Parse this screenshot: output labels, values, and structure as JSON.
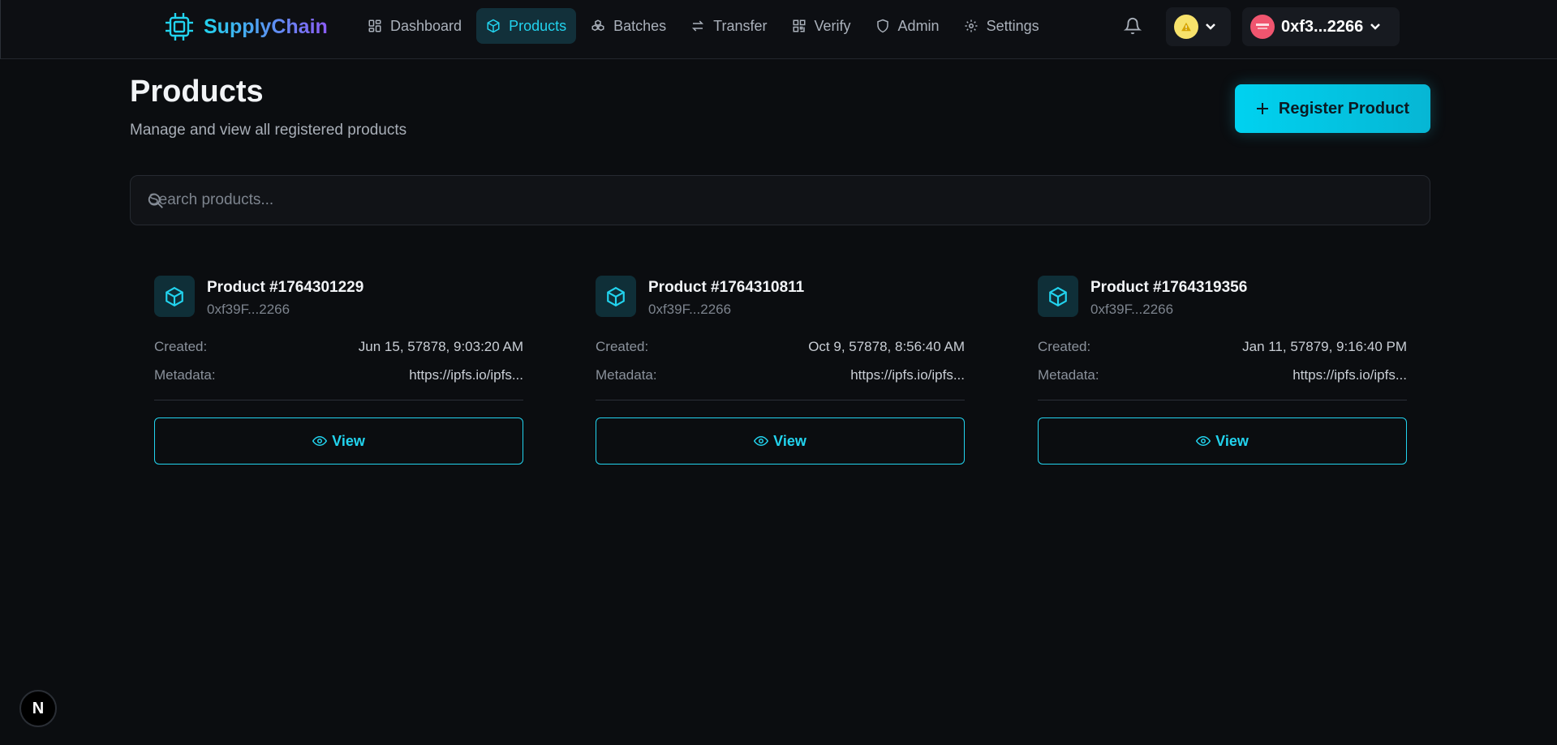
{
  "app": {
    "name": "SupplyChain"
  },
  "nav": {
    "items": [
      {
        "label": "Dashboard",
        "icon": "grid-icon",
        "active": false
      },
      {
        "label": "Products",
        "icon": "box-icon",
        "active": true
      },
      {
        "label": "Batches",
        "icon": "boxes-icon",
        "active": false
      },
      {
        "label": "Transfer",
        "icon": "arrows-icon",
        "active": false
      },
      {
        "label": "Verify",
        "icon": "qr-icon",
        "active": false
      },
      {
        "label": "Admin",
        "icon": "shield-icon",
        "active": false
      },
      {
        "label": "Settings",
        "icon": "gear-icon",
        "active": false
      }
    ]
  },
  "account": {
    "address": "0xf3...2266"
  },
  "page": {
    "title": "Products",
    "subtitle": "Manage and view all registered products",
    "register_label": "Register Product"
  },
  "search": {
    "placeholder": "Search products..."
  },
  "labels": {
    "created": "Created:",
    "metadata": "Metadata:",
    "view": "View"
  },
  "products": [
    {
      "title": "Product #1764301229",
      "owner": "0xf39F...2266",
      "created": "Jun 15, 57878, 9:03:20 AM",
      "metadata": "https://ipfs.io/ipfs..."
    },
    {
      "title": "Product #1764310811",
      "owner": "0xf39F...2266",
      "created": "Oct 9, 57878, 8:56:40 AM",
      "metadata": "https://ipfs.io/ipfs..."
    },
    {
      "title": "Product #1764319356",
      "owner": "0xf39F...2266",
      "created": "Jan 11, 57879, 9:16:40 PM",
      "metadata": "https://ipfs.io/ipfs..."
    }
  ],
  "badge": {
    "letter": "N"
  },
  "colors": {
    "accent": "#22d3ee",
    "background": "#0b0d10",
    "brand_gradient_end": "#8b5cf6"
  }
}
